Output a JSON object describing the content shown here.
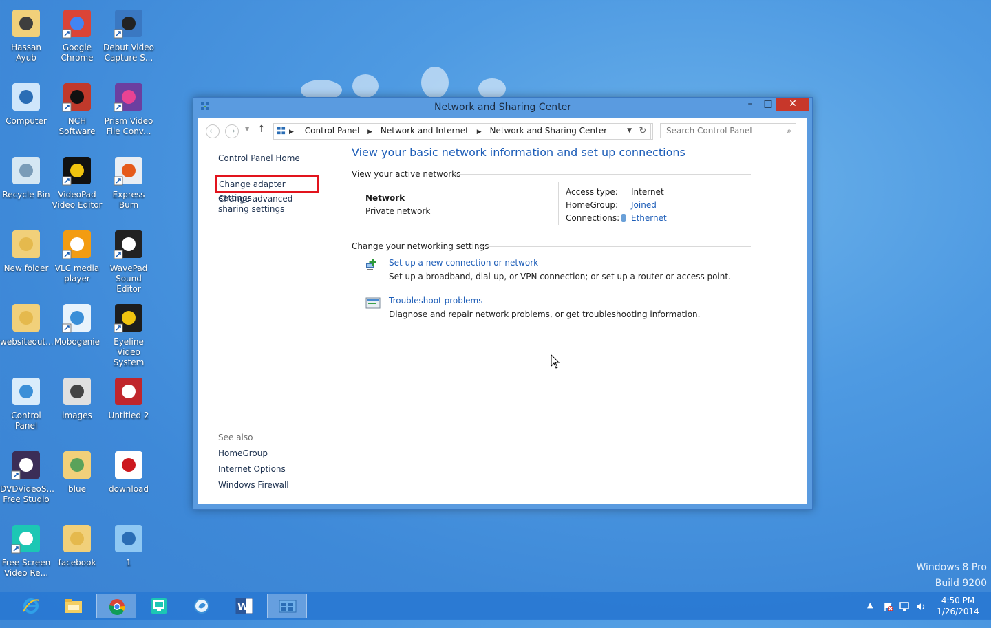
{
  "desktop": {
    "icons": [
      {
        "label": "Hassan Ayub"
      },
      {
        "label": "Google Chrome"
      },
      {
        "label": "Debut Video Capture S..."
      },
      {
        "label": "Computer"
      },
      {
        "label": "NCH Software"
      },
      {
        "label": "Prism Video File Conv..."
      },
      {
        "label": "Recycle Bin"
      },
      {
        "label": "VideoPad Video Editor"
      },
      {
        "label": "Express Burn"
      },
      {
        "label": "New folder"
      },
      {
        "label": "VLC media player"
      },
      {
        "label": "WavePad Sound Editor"
      },
      {
        "label": "websiteout..."
      },
      {
        "label": "Mobogenie"
      },
      {
        "label": "Eyeline Video System"
      },
      {
        "label": "Control Panel"
      },
      {
        "label": "images"
      },
      {
        "label": "Untitled 2"
      },
      {
        "label": "DVDVideoS... Free Studio"
      },
      {
        "label": "blue"
      },
      {
        "label": "download"
      },
      {
        "label": "Free Screen Video Re..."
      },
      {
        "label": "facebook"
      },
      {
        "label": "1"
      }
    ],
    "watermark_line1": "Windows 8 Pro",
    "watermark_line2": "Build 9200"
  },
  "window": {
    "title": "Network and Sharing Center",
    "min_glyph": "–",
    "max_glyph": "□",
    "close_glyph": "✕",
    "address": {
      "crumbs": [
        "Control Panel",
        "Network and Internet",
        "Network and Sharing Center"
      ],
      "separator": "▶"
    },
    "search_placeholder": "Search Control Panel",
    "left_pane": {
      "home": "Control Panel Home",
      "adapter": "Change adapter settings",
      "advanced": "Change advanced sharing settings",
      "see_also": "See also",
      "see_also_links": [
        "HomeGroup",
        "Internet Options",
        "Windows Firewall"
      ]
    },
    "main": {
      "heading": "View your basic network information and set up connections",
      "active_networks_label": "View your active networks",
      "network_name": "Network",
      "network_type": "Private network",
      "access_type_key": "Access type:",
      "access_type_val": "Internet",
      "homegroup_key": "HomeGroup:",
      "homegroup_val": "Joined",
      "connections_key": "Connections:",
      "connections_val": "Ethernet",
      "change_settings_label": "Change your networking settings",
      "tasks": [
        {
          "link": "Set up a new connection or network",
          "desc": "Set up a broadband, dial-up, or VPN connection; or set up a router or access point."
        },
        {
          "link": "Troubleshoot problems",
          "desc": "Diagnose and repair network problems, or get troubleshooting information."
        }
      ]
    }
  },
  "taskbar": {
    "items": [
      "internet-explorer",
      "file-explorer",
      "google-chrome",
      "free-screen-video-recorder",
      "mobogenie",
      "microsoft-word",
      "control-panel"
    ],
    "clock_time": "4:50 PM",
    "clock_date": "1/26/2014"
  }
}
